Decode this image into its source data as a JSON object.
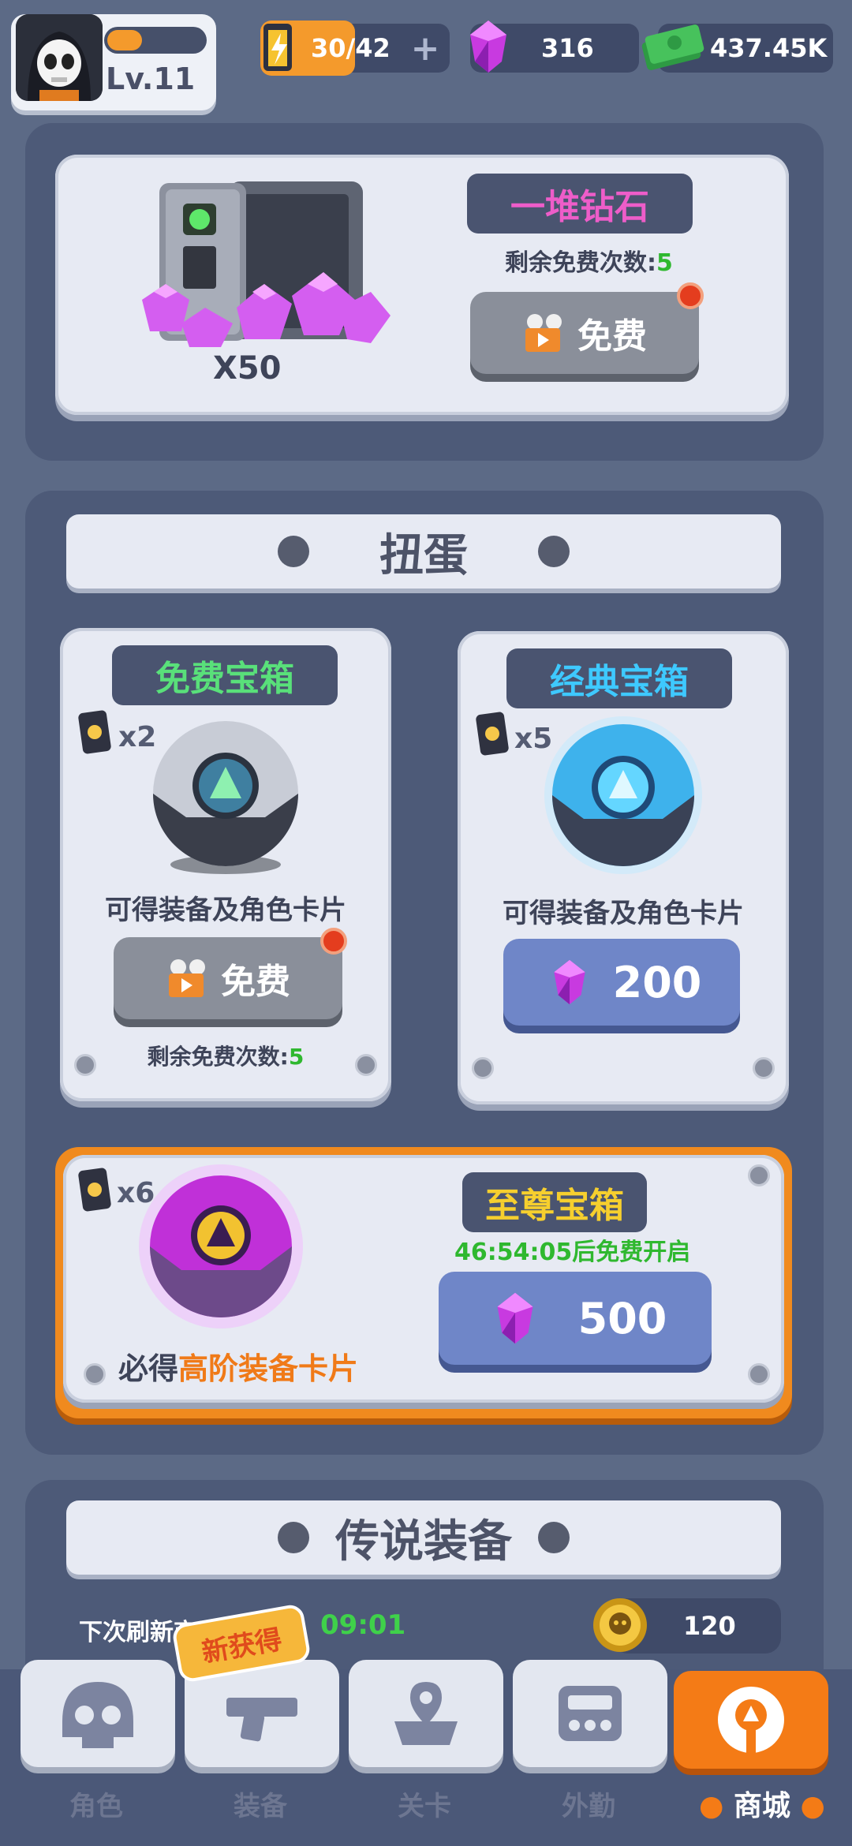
{
  "player": {
    "level": "Lv.11"
  },
  "resources": {
    "energy": "30/42",
    "gems": "316",
    "cash": "437.45K"
  },
  "diamond_pile": {
    "title": "一堆钻石",
    "free_left_label": "剩余免费次数:",
    "free_left_value": "5",
    "amount": "X50",
    "button_label": "免费"
  },
  "gacha": {
    "section_title": "扭蛋",
    "free_chest": {
      "title": "免费宝箱",
      "cards": "x2",
      "desc": "可得装备及角色卡片",
      "button_label": "免费",
      "free_left_label": "剩余免费次数:",
      "free_left_value": "5"
    },
    "classic_chest": {
      "title": "经典宝箱",
      "cards": "x5",
      "desc": "可得装备及角色卡片",
      "price": "200"
    },
    "supreme_chest": {
      "title": "至尊宝箱",
      "cards": "x6",
      "timer": "46:54:05后免费开启",
      "desc_prefix": "必得",
      "desc_highlight": "高阶装备卡片",
      "price": "500"
    }
  },
  "legend": {
    "section_title": "传说装备",
    "refresh_label": "下次刷新商品",
    "refresh_time": "09:01",
    "coin_amount": "120"
  },
  "nav": {
    "items": [
      {
        "label": "角色"
      },
      {
        "label": "装备",
        "badge": "新获得"
      },
      {
        "label": "关卡"
      },
      {
        "label": "外勤"
      },
      {
        "label": "商城"
      }
    ]
  },
  "colors": {
    "accent_orange": "#f47b16",
    "free_green": "#2fb82f",
    "gem_purple": "#c83ae0"
  }
}
